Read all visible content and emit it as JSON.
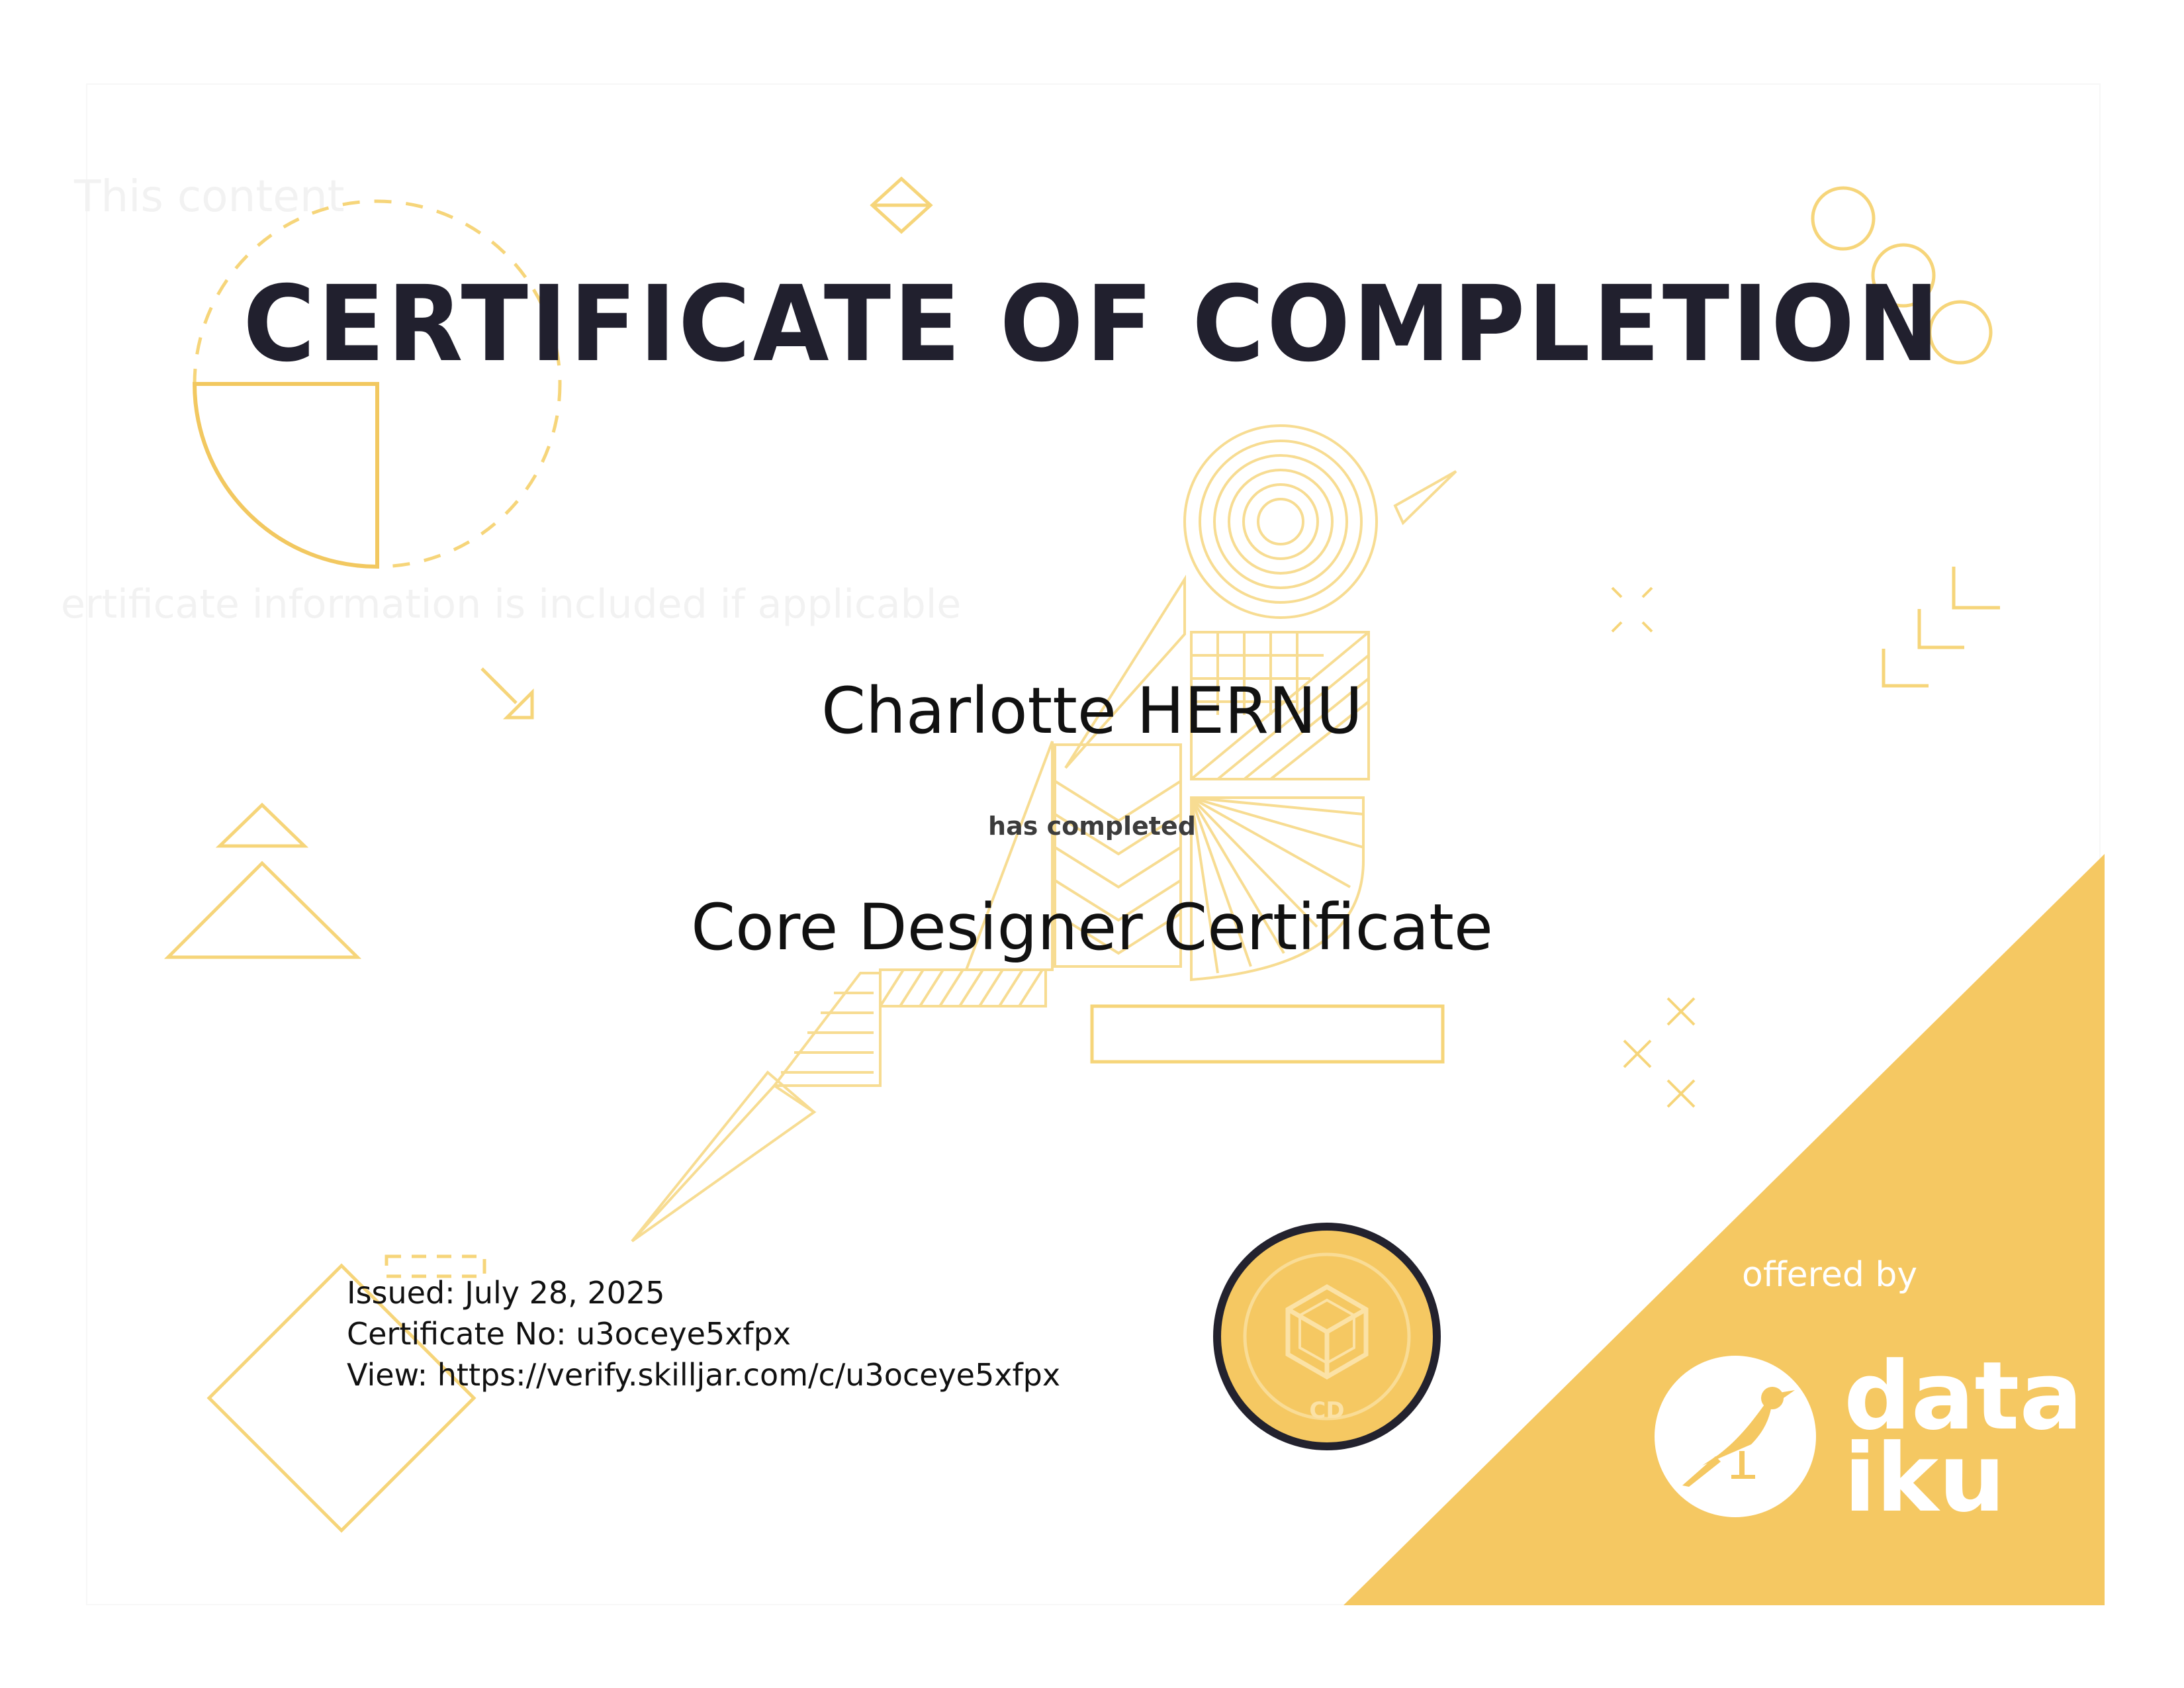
{
  "certificate": {
    "title": "CERTIFICATE OF COMPLETION",
    "recipient_name": "Charlotte HERNU",
    "completion_phrase": "has completed",
    "course_name": "Core Designer Certificate",
    "issued": "Issued: July 28, 2025",
    "certificate_number": "Certificate No: u3oceye5xfpx",
    "view_link": "View: https://verify.skilljar.com/c/u3oceye5xfpx"
  },
  "placeholder_text": {
    "top": "This content",
    "middle": "ertificate information is included if applicable"
  },
  "badge": {
    "label": "CD"
  },
  "provider": {
    "offered_by": "offered by",
    "logo_line1": "data",
    "logo_line2": "iku"
  },
  "colors": {
    "accent_yellow": "#f5c862",
    "line_yellow": "#f6d57a",
    "title_dark": "#21202e",
    "badge_border": "#23222e"
  },
  "icons": {
    "bird_illustration": "geometric-bird",
    "logo": "dataiku-bird-logo",
    "badge_icon": "cube-icon"
  }
}
